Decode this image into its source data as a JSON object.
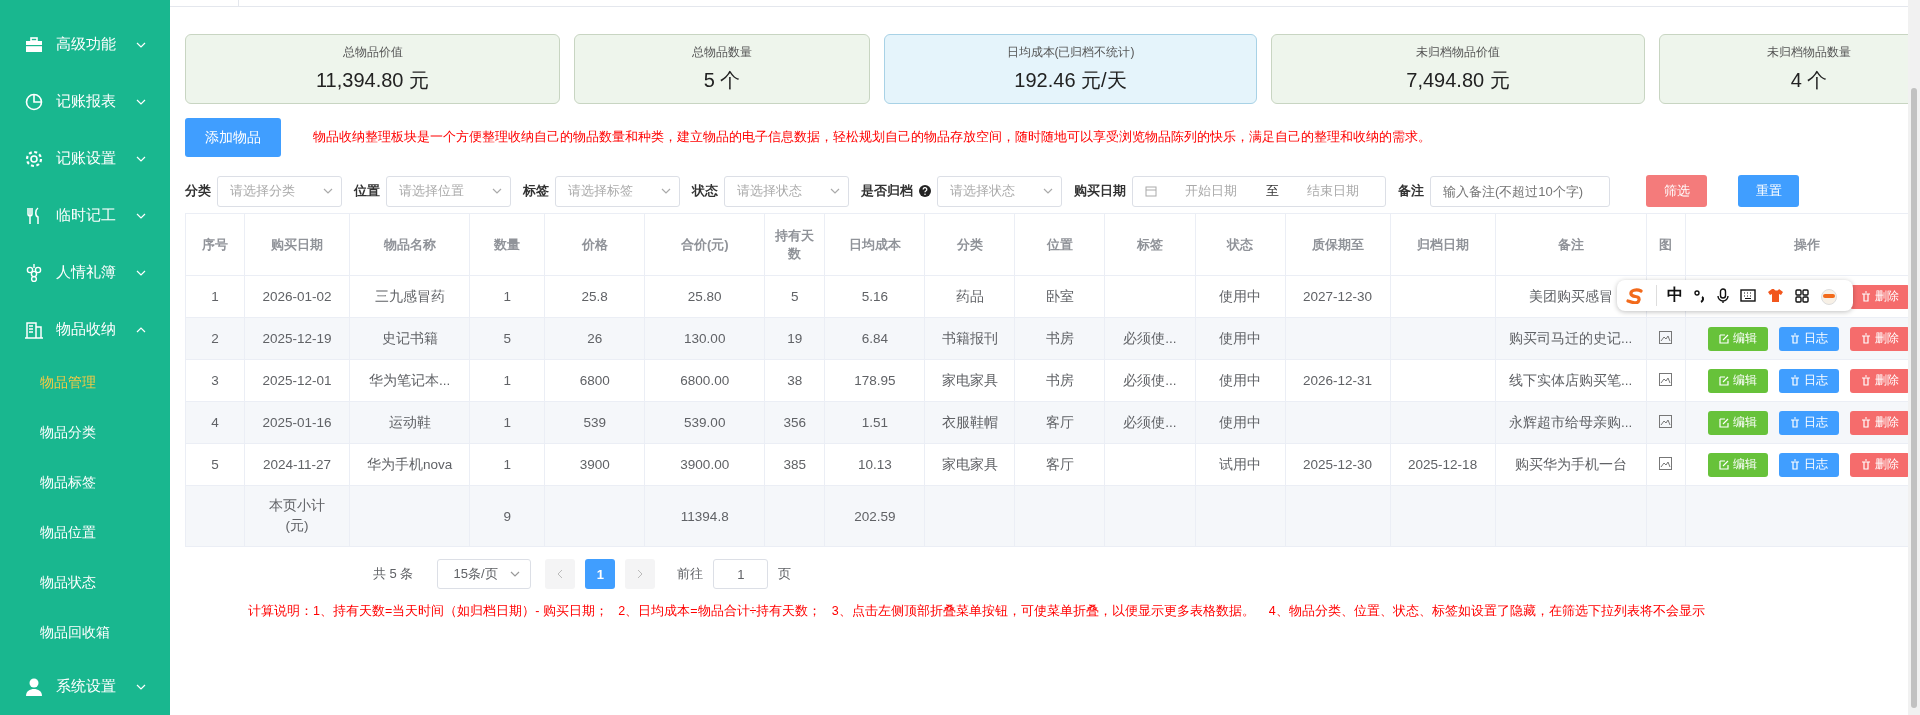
{
  "sidebar": {
    "items": [
      {
        "label": "高级功能",
        "expanded": false
      },
      {
        "label": "记账报表",
        "expanded": false
      },
      {
        "label": "记账设置",
        "expanded": false
      },
      {
        "label": "临时记工",
        "expanded": false
      },
      {
        "label": "人情礼簿",
        "expanded": false
      },
      {
        "label": "物品收纳",
        "expanded": true,
        "children": [
          {
            "label": "物品管理",
            "selected": true
          },
          {
            "label": "物品分类",
            "selected": false
          },
          {
            "label": "物品标签",
            "selected": false
          },
          {
            "label": "物品位置",
            "selected": false
          },
          {
            "label": "物品状态",
            "selected": false
          },
          {
            "label": "物品回收箱",
            "selected": false
          }
        ]
      },
      {
        "label": "系统设置",
        "expanded": false
      }
    ]
  },
  "summary_cards": [
    {
      "label": "总物品价值",
      "value": "11,394.80 元",
      "highlighted": false
    },
    {
      "label": "总物品数量",
      "value": "5 个",
      "highlighted": false
    },
    {
      "label": "日均成本(已归档不统计)",
      "value": "192.46 元/天",
      "highlighted": true
    },
    {
      "label": "未归档物品价值",
      "value": "7,494.80 元",
      "highlighted": false
    },
    {
      "label": "未归档物品数量",
      "value": "4 个",
      "highlighted": false
    }
  ],
  "add_button": "添加物品",
  "intro_text": "物品收纳整理板块是一个方便整理收纳自己的物品数量和种类，建立物品的电子信息数据，轻松规划自己的物品存放空间，随时随地可以享受浏览物品陈列的快乐，满足自己的整理和收纳的需求。",
  "filters": [
    {
      "kind": "select",
      "label": "分类",
      "placeholder": "请选择分类"
    },
    {
      "kind": "select",
      "label": "位置",
      "placeholder": "请选择位置"
    },
    {
      "kind": "select",
      "label": "标签",
      "placeholder": "请选择标签"
    },
    {
      "kind": "select",
      "label": "状态",
      "placeholder": "请选择状态"
    },
    {
      "kind": "select",
      "label": "是否归档",
      "placeholder": "请选择状态",
      "help": true
    },
    {
      "kind": "date_range",
      "label": "购买日期",
      "placeholder": "开始日期",
      "separator": "至",
      "end_placeholder": "结束日期"
    },
    {
      "kind": "text",
      "label": "备注",
      "placeholder": "输入备注(不超过10个字)"
    }
  ],
  "filter_button": "筛选",
  "reset_button": "重置",
  "table": {
    "columns": [
      "序号",
      "购买日期",
      "物品名称",
      "数量",
      "价格",
      "合价(元)",
      "持有天数",
      "日均成本",
      "分类",
      "位置",
      "标签",
      "状态",
      "质保期至",
      "归档日期",
      "备注",
      "图",
      "操作"
    ],
    "rows": [
      {
        "index": "1",
        "date": "2026-01-02",
        "name": "三九感冒药",
        "qty": "1",
        "price": "25.8",
        "total": "25.80",
        "days": "5",
        "daily": "5.16",
        "category": "药品",
        "location": "卧室",
        "status": "使用中",
        "warranty": "2027-12-30",
        "remark": "美团购买感冒",
        "actions": [
          {
            "kind": "delete",
            "label": "删除"
          }
        ]
      },
      {
        "index": "2",
        "date": "2025-12-19",
        "name": "史记书籍",
        "qty": "5",
        "price": "26",
        "total": "130.00",
        "days": "19",
        "daily": "6.84",
        "category": "书籍报刊",
        "location": "书房",
        "tag": "必须使...",
        "status": "使用中",
        "remark": "购买司马迁的史记...",
        "image_icon": true,
        "actions": [
          {
            "kind": "edit",
            "label": "编辑"
          },
          {
            "kind": "log",
            "label": "日志"
          },
          {
            "kind": "delete",
            "label": "删除"
          }
        ]
      },
      {
        "index": "3",
        "date": "2025-12-01",
        "name": "华为笔记本...",
        "qty": "1",
        "price": "6800",
        "total": "6800.00",
        "days": "38",
        "daily": "178.95",
        "category": "家电家具",
        "location": "书房",
        "tag": "必须使...",
        "status": "使用中",
        "warranty": "2026-12-31",
        "remark": "线下实体店购买笔...",
        "image_icon": true,
        "actions": [
          {
            "kind": "edit",
            "label": "编辑"
          },
          {
            "kind": "log",
            "label": "日志"
          },
          {
            "kind": "delete",
            "label": "删除"
          }
        ]
      },
      {
        "index": "4",
        "date": "2025-01-16",
        "name": "运动鞋",
        "qty": "1",
        "price": "539",
        "total": "539.00",
        "days": "356",
        "daily": "1.51",
        "category": "衣服鞋帽",
        "location": "客厅",
        "tag": "必须使...",
        "status": "使用中",
        "remark": "永辉超市给母亲购...",
        "image_icon": true,
        "actions": [
          {
            "kind": "edit",
            "label": "编辑"
          },
          {
            "kind": "log",
            "label": "日志"
          },
          {
            "kind": "delete",
            "label": "删除"
          }
        ]
      },
      {
        "index": "5",
        "date": "2024-11-27",
        "name": "华为手机nova",
        "qty": "1",
        "price": "3900",
        "total": "3900.00",
        "days": "385",
        "daily": "10.13",
        "category": "家电家具",
        "location": "客厅",
        "status": "试用中",
        "warranty": "2025-12-30",
        "archived": "2025-12-18",
        "remark": "购买华为手机一台",
        "image_icon": true,
        "actions": [
          {
            "kind": "edit",
            "label": "编辑"
          },
          {
            "kind": "log",
            "label": "日志"
          },
          {
            "kind": "delete",
            "label": "删除"
          }
        ]
      }
    ],
    "subtotal": {
      "label": "本页小计(元)",
      "qty": "9",
      "total": "11394.8",
      "daily": "202.59"
    }
  },
  "pagination": {
    "total": "共 5 条",
    "page_size": "15条/页",
    "pages": [
      {
        "label": "1",
        "selected": true
      }
    ],
    "goto_label": "前往",
    "goto_value": "1",
    "goto_suffix": "页"
  },
  "note": "计算说明：1、持有天数=当天时间（如归档日期）- 购买日期；   2、日均成本=物品合计÷持有天数；   3、点击左侧顶部折叠菜单按钮，可使菜单折叠，以便显示更多表格数据。    4、物品分类、位置、状态、标签如设置了隐藏，在筛选下拉列表将不会显示",
  "ime_toolbar": {
    "mode": "中"
  }
}
